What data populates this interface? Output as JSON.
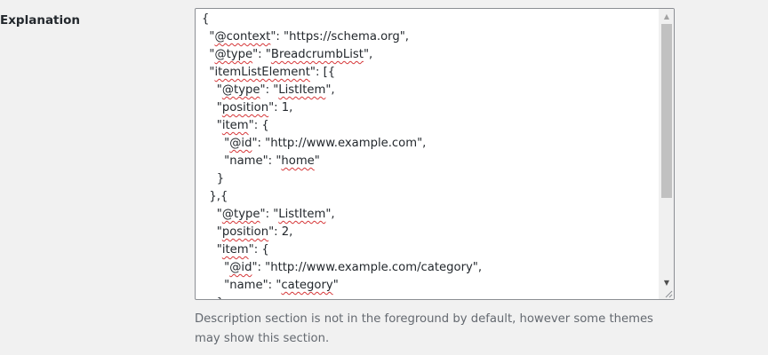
{
  "field": {
    "label": "Explanation"
  },
  "editor": {
    "lines": [
      [
        {
          "t": "{"
        }
      ],
      [
        {
          "t": "  \""
        },
        {
          "t": "@context",
          "s": true
        },
        {
          "t": "\": \"https://schema.org\","
        }
      ],
      [
        {
          "t": "  \""
        },
        {
          "t": "@type",
          "s": true
        },
        {
          "t": "\": \""
        },
        {
          "t": "BreadcrumbList",
          "s": true
        },
        {
          "t": "\","
        }
      ],
      [
        {
          "t": "  \""
        },
        {
          "t": "itemListElement",
          "s": true
        },
        {
          "t": "\": [{"
        }
      ],
      [
        {
          "t": "    \""
        },
        {
          "t": "@type",
          "s": true
        },
        {
          "t": "\": \""
        },
        {
          "t": "ListItem",
          "s": true
        },
        {
          "t": "\","
        }
      ],
      [
        {
          "t": "    \""
        },
        {
          "t": "position",
          "s": true
        },
        {
          "t": "\": 1,"
        }
      ],
      [
        {
          "t": "    \""
        },
        {
          "t": "item",
          "s": true
        },
        {
          "t": "\": {"
        }
      ],
      [
        {
          "t": "      \""
        },
        {
          "t": "@id",
          "s": true
        },
        {
          "t": "\": \"http://www.example.com\","
        }
      ],
      [
        {
          "t": "      \"name\": \""
        },
        {
          "t": "home",
          "s": true
        },
        {
          "t": "\""
        }
      ],
      [
        {
          "t": "    }"
        }
      ],
      [
        {
          "t": "  },{"
        }
      ],
      [
        {
          "t": "    \""
        },
        {
          "t": "@type",
          "s": true
        },
        {
          "t": "\": \""
        },
        {
          "t": "ListItem",
          "s": true
        },
        {
          "t": "\","
        }
      ],
      [
        {
          "t": "    \""
        },
        {
          "t": "position",
          "s": true
        },
        {
          "t": "\": 2,"
        }
      ],
      [
        {
          "t": "    \""
        },
        {
          "t": "item",
          "s": true
        },
        {
          "t": "\": {"
        }
      ],
      [
        {
          "t": "      \""
        },
        {
          "t": "@id",
          "s": true
        },
        {
          "t": "\": \"http://www.example.com/category\","
        }
      ],
      [
        {
          "t": "      \"name\": \""
        },
        {
          "t": "category",
          "s": true
        },
        {
          "t": "\""
        }
      ],
      [
        {
          "t": "    }"
        }
      ]
    ]
  },
  "description": "Description section is not in the foreground by default, however some themes may show this section."
}
